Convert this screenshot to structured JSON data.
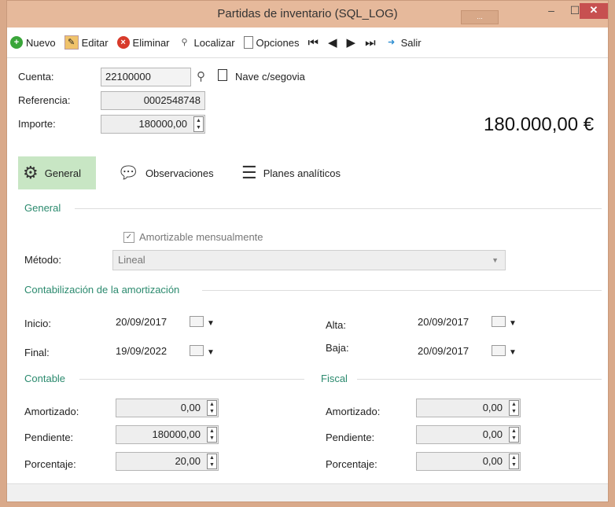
{
  "window": {
    "title": "Partidas de inventario (SQL_LOG)",
    "title_dots": "...",
    "min_glyph": "–",
    "max_glyph": "☐",
    "close_glyph": "✕"
  },
  "toolbar": {
    "nuevo": "Nuevo",
    "editar": "Editar",
    "eliminar": "Eliminar",
    "localizar": "Localizar",
    "opciones": "Opciones",
    "salir": "Salir",
    "first_glyph": "⏮",
    "prev_glyph": "◀",
    "next_glyph": "▶",
    "last_glyph": "⏭"
  },
  "header": {
    "cuenta_label": "Cuenta:",
    "cuenta_value": "22100000",
    "cuenta_desc": "Nave c/segovia",
    "referencia_label": "Referencia:",
    "referencia_value": "0002548748",
    "importe_label": "Importe:",
    "importe_value": "180000,00",
    "importe_display": "180.000,00 €"
  },
  "tabs": [
    {
      "label": "General",
      "icon": "gears-icon",
      "active": true
    },
    {
      "label": "Observaciones",
      "icon": "speech-bubble-icon",
      "active": false
    },
    {
      "label": "Planes analíticos",
      "icon": "list-doc-icon",
      "active": false
    }
  ],
  "general": {
    "section_title": "General",
    "amortizable_label": "Amortizable mensualmente",
    "amortizable_checked": true,
    "metodo_label": "Método:",
    "metodo_value": "Lineal"
  },
  "contabilizacion": {
    "section_title": "Contabilización de la amortización",
    "inicio_label": "Inicio:",
    "inicio_value": "20/09/2017",
    "final_label": "Final:",
    "final_value": "19/09/2022",
    "alta_label": "Alta:",
    "alta_value": "20/09/2017",
    "baja_label": "Baja:",
    "baja_value": "20/09/2017"
  },
  "contable": {
    "section_title": "Contable",
    "amortizado_label": "Amortizado:",
    "amortizado_value": "0,00",
    "pendiente_label": "Pendiente:",
    "pendiente_value": "180000,00",
    "porcentaje_label": "Porcentaje:",
    "porcentaje_value": "20,00"
  },
  "fiscal": {
    "section_title": "Fiscal",
    "amortizado_label": "Amortizado:",
    "amortizado_value": "0,00",
    "pendiente_label": "Pendiente:",
    "pendiente_value": "0,00",
    "porcentaje_label": "Porcentaje:",
    "porcentaje_value": "0,00"
  },
  "colors": {
    "titlebar": "#e6b99b",
    "accent_section": "#2b8a6e",
    "tab_active": "#c8e6c4",
    "close_button": "#c75050"
  }
}
